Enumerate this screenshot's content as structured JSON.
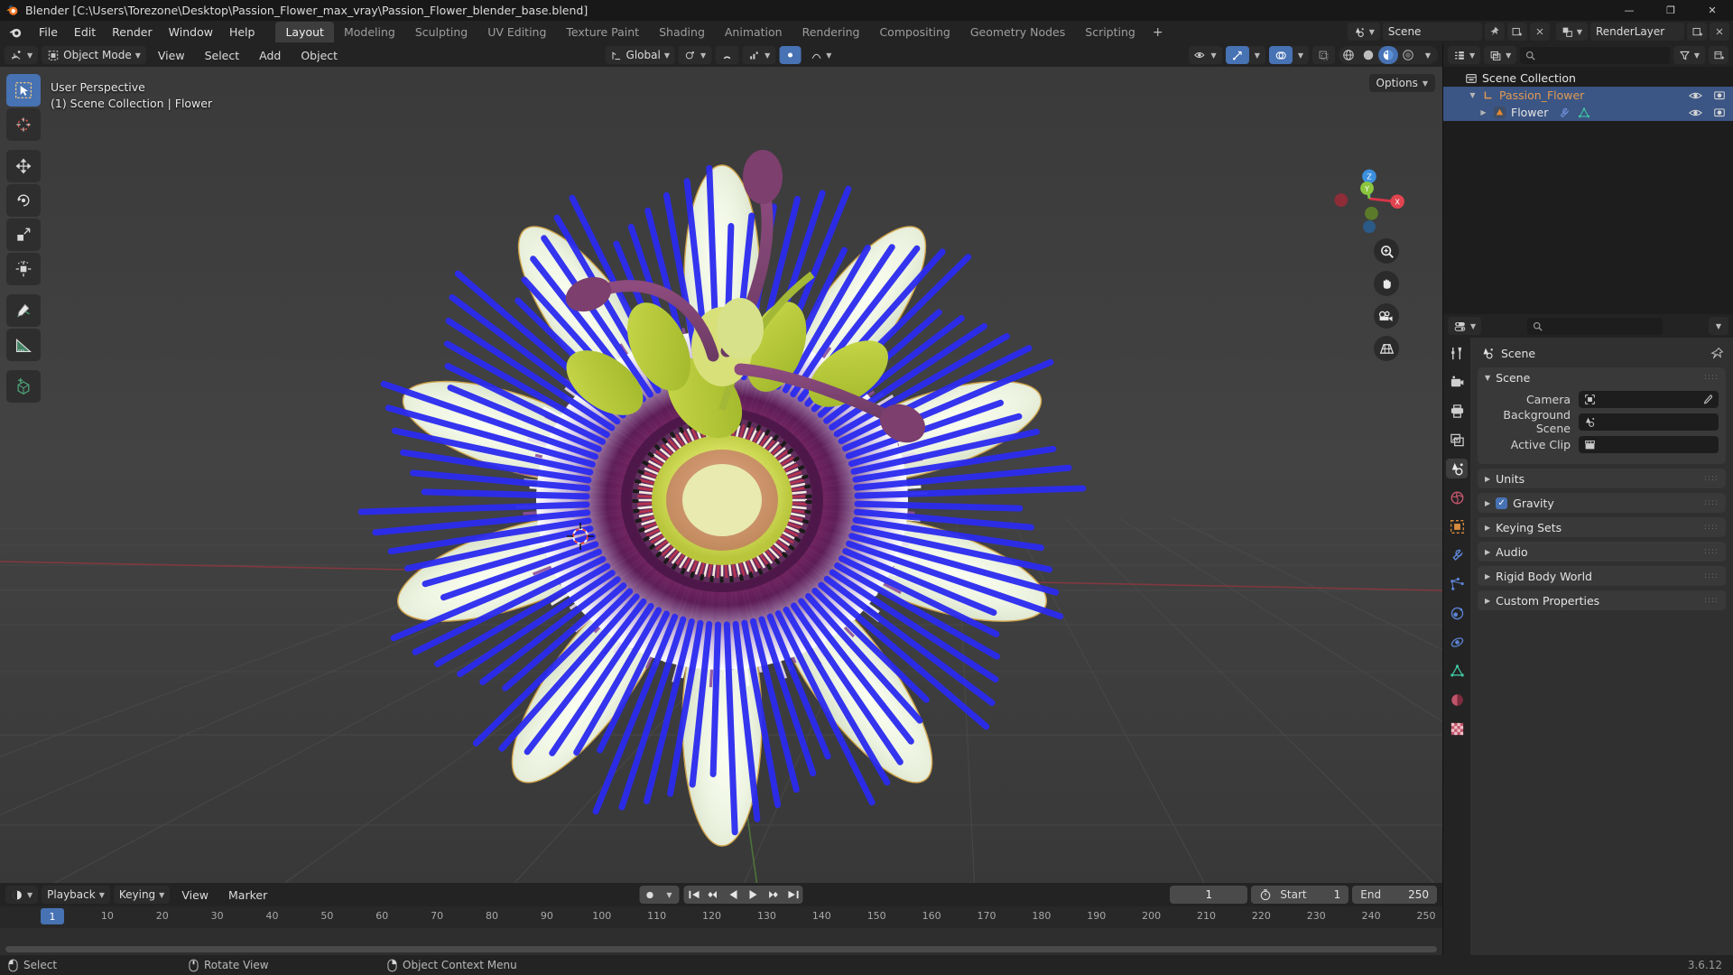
{
  "window": {
    "title": "Blender [C:\\Users\\Torezone\\Desktop\\Passion_Flower_max_vray\\Passion_Flower_blender_base.blend]",
    "minimize": "—",
    "maximize": "❐",
    "close": "✕"
  },
  "topbar": {
    "menus": [
      "File",
      "Edit",
      "Render",
      "Window",
      "Help"
    ],
    "workspaces": [
      {
        "label": "Layout",
        "active": true
      },
      {
        "label": "Modeling",
        "active": false
      },
      {
        "label": "Sculpting",
        "active": false
      },
      {
        "label": "UV Editing",
        "active": false
      },
      {
        "label": "Texture Paint",
        "active": false
      },
      {
        "label": "Shading",
        "active": false
      },
      {
        "label": "Animation",
        "active": false
      },
      {
        "label": "Rendering",
        "active": false
      },
      {
        "label": "Compositing",
        "active": false
      },
      {
        "label": "Geometry Nodes",
        "active": false
      },
      {
        "label": "Scripting",
        "active": false
      }
    ],
    "add_workspace": "+",
    "scene_name": "Scene",
    "view_layer_name": "RenderLayer"
  },
  "viewport_header": {
    "editor_type": "editor-type-icon",
    "mode": "Object Mode",
    "menus": [
      "View",
      "Select",
      "Add",
      "Object"
    ],
    "transform_orientation": "Global",
    "select_modes": [
      "tweak",
      "box",
      "circle",
      "lasso",
      "select-box-extend"
    ]
  },
  "viewport": {
    "overlay_line1": "User Perspective",
    "overlay_line2": "(1) Scene Collection | Flower",
    "options_label": "Options",
    "gizmo_axes": [
      "X",
      "Y",
      "Z"
    ],
    "tools": [
      {
        "name": "tweak-tool",
        "active": true
      },
      {
        "name": "cursor-tool",
        "active": false
      },
      {
        "name": "move-tool",
        "active": false
      },
      {
        "name": "rotate-tool",
        "active": false
      },
      {
        "name": "scale-tool",
        "active": false
      },
      {
        "name": "transform-tool",
        "active": false
      },
      {
        "name": "annotate-tool",
        "active": false
      },
      {
        "name": "measure-tool",
        "active": false
      },
      {
        "name": "add-cube-tool",
        "active": false
      }
    ],
    "nav_buttons": [
      "zoom-icon",
      "pan-icon",
      "camera-icon",
      "ortho-grid-icon"
    ]
  },
  "outliner": {
    "display_mode": "View Layer",
    "search_placeholder": "",
    "rows": [
      {
        "label": "Scene Collection",
        "icon": "collection-icon",
        "indent": 0,
        "selected": false,
        "expandable": false,
        "visibility": false
      },
      {
        "label": "Passion_Flower",
        "icon": "empty-axes-icon",
        "indent": 1,
        "selected": true,
        "expandable": true,
        "expanded": true,
        "visibility": true
      },
      {
        "label": "Flower",
        "icon": "mesh-data-icon",
        "indent": 2,
        "selected": true,
        "expandable": true,
        "expanded": false,
        "visibility": true,
        "badges": [
          "modifier-icon",
          "mesh-triangle-icon"
        ]
      }
    ]
  },
  "properties": {
    "search_placeholder": "",
    "breadcrumb": "Scene",
    "tabs": [
      {
        "name": "tool-tab",
        "active": false
      },
      {
        "name": "render-tab",
        "active": false
      },
      {
        "name": "output-tab",
        "active": false
      },
      {
        "name": "view-layer-tab",
        "active": false
      },
      {
        "name": "scene-tab",
        "active": true
      },
      {
        "name": "world-tab",
        "active": false
      },
      {
        "name": "object-tab",
        "active": false
      },
      {
        "name": "modifier-tab",
        "active": false
      },
      {
        "name": "particles-tab",
        "active": false
      },
      {
        "name": "physics-tab",
        "active": false
      },
      {
        "name": "constraint-tab",
        "active": false
      },
      {
        "name": "object-data-tab",
        "active": false
      },
      {
        "name": "material-tab",
        "active": false
      },
      {
        "name": "texture-tab",
        "active": false
      }
    ],
    "scene_panel": {
      "title": "Scene",
      "expanded": true,
      "fields": [
        {
          "label": "Camera",
          "value": "",
          "icon": "camera-object-icon",
          "has_eyedropper": true
        },
        {
          "label": "Background Scene",
          "value": "",
          "icon": "scene-icon",
          "has_eyedropper": false
        },
        {
          "label": "Active Clip",
          "value": "",
          "icon": "clip-icon",
          "has_eyedropper": false
        }
      ]
    },
    "panels": [
      {
        "label": "Units",
        "expanded": false,
        "checkbox": null
      },
      {
        "label": "Gravity",
        "expanded": false,
        "checkbox": true
      },
      {
        "label": "Keying Sets",
        "expanded": false,
        "checkbox": null
      },
      {
        "label": "Audio",
        "expanded": false,
        "checkbox": null
      },
      {
        "label": "Rigid Body World",
        "expanded": false,
        "checkbox": null
      },
      {
        "label": "Custom Properties",
        "expanded": false,
        "checkbox": null
      }
    ]
  },
  "timeline": {
    "menus": [
      "Playback",
      "Keying",
      "View",
      "Marker"
    ],
    "playback_buttons": [
      "jump-start",
      "prev-keyframe",
      "play-reverse",
      "play",
      "next-keyframe",
      "jump-end"
    ],
    "auto_key": "record-icon",
    "current_frame": "1",
    "start_label": "Start",
    "start_value": "1",
    "end_label": "End",
    "end_value": "250",
    "ticks": [
      "10",
      "20",
      "30",
      "40",
      "50",
      "60",
      "70",
      "80",
      "90",
      "100",
      "110",
      "120",
      "130",
      "140",
      "150",
      "160",
      "170",
      "180",
      "190",
      "200",
      "210",
      "220",
      "230",
      "240",
      "250"
    ],
    "playhead_frame": "1"
  },
  "statusbar": {
    "items": [
      {
        "icon": "mouse-left-icon",
        "label": "Select"
      },
      {
        "icon": "mouse-middle-icon",
        "label": "Rotate View"
      },
      {
        "icon": "mouse-right-icon",
        "label": "Object Context Menu"
      }
    ],
    "version": "3.6.12"
  },
  "colors": {
    "accent": "#4772b3",
    "header": "#232323",
    "panel": "#303030",
    "outliner_selected": "#3b5584",
    "collection_orange": "#d79b5a"
  }
}
